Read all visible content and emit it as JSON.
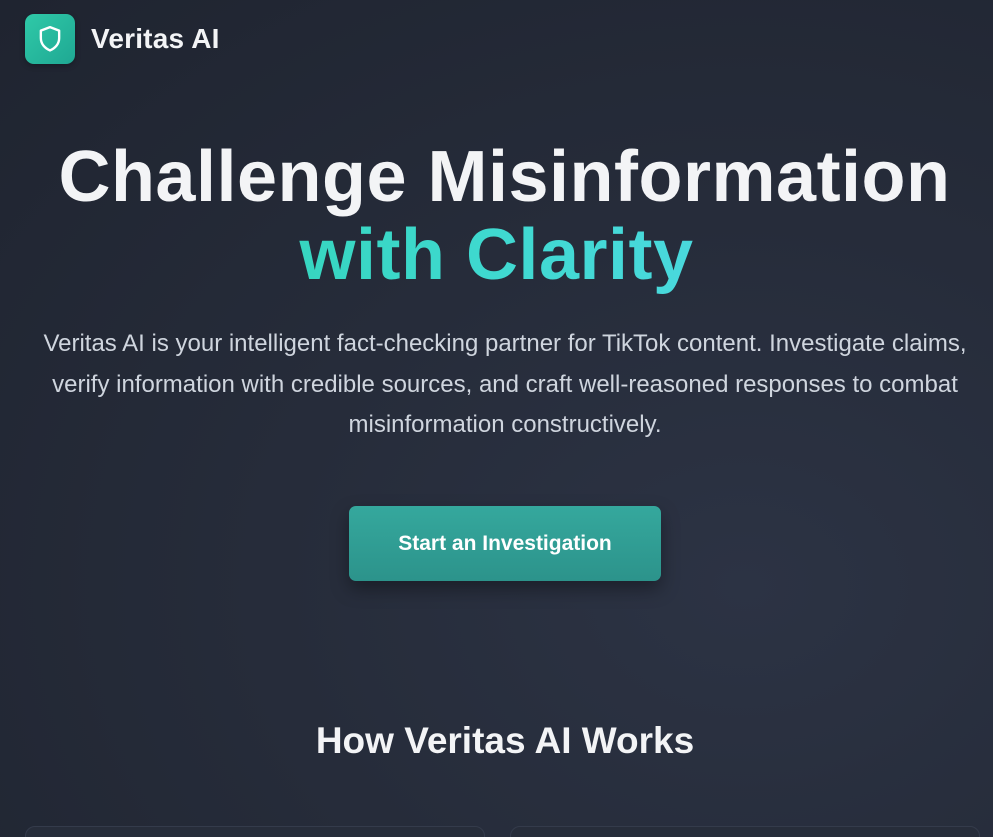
{
  "brand": {
    "name": "Veritas AI",
    "icon": "shield-icon",
    "accent_color": "#2fc9a8"
  },
  "hero": {
    "title_line1": "Challenge Misinformation",
    "title_line2": "with Clarity",
    "description": "Veritas AI is your intelligent fact-checking partner for TikTok content. Investigate claims, verify information with credible sources, and craft well-reasoned responses to combat misinformation constructively.",
    "cta_label": "Start an Investigation"
  },
  "how_it_works": {
    "title": "How Veritas AI Works"
  }
}
